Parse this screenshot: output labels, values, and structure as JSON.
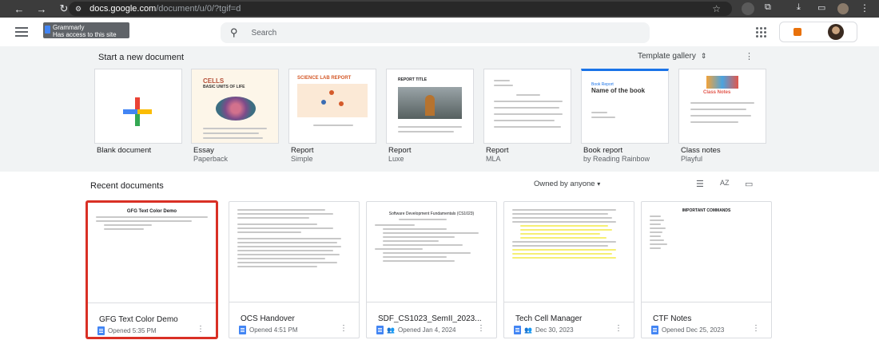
{
  "browser": {
    "url_host": "docs.google.com",
    "url_path": "/document/u/0/?tgif=d"
  },
  "grammarly": {
    "name": "Grammarly",
    "note": "Has access to this site"
  },
  "search": {
    "placeholder": "Search"
  },
  "templates": {
    "heading": "Start a new document",
    "gallery_label": "Template gallery",
    "items": [
      {
        "name": "Blank document",
        "sub": ""
      },
      {
        "name": "Essay",
        "sub": "Paperback"
      },
      {
        "name": "Report",
        "sub": "Simple"
      },
      {
        "name": "Report",
        "sub": "Luxe"
      },
      {
        "name": "Report",
        "sub": "MLA"
      },
      {
        "name": "Book report",
        "sub": "by Reading Rainbow"
      },
      {
        "name": "Class notes",
        "sub": "Playful"
      }
    ],
    "thumb_text": {
      "essay_title": "CELLS",
      "essay_sub": "BASIC UNITS OF LIFE",
      "science": "SCIENCE LAB REPORT",
      "luxe_title": "REPORT TITLE",
      "book_label": "Book Report",
      "book_title": "Name of the book",
      "class_title": "Class Notes"
    }
  },
  "recent": {
    "heading": "Recent documents",
    "owner_filter": "Owned by anyone",
    "docs": [
      {
        "name": "GFG Text Color Demo",
        "opened": "Opened 5:35 PM",
        "shared": false,
        "preview_title": "GFG Text Color Demo"
      },
      {
        "name": "OCS Handover",
        "opened": "Opened 4:51 PM",
        "shared": false,
        "preview_title": ""
      },
      {
        "name": "SDF_CS1023_SemII_2023...",
        "opened": "Opened Jan 4, 2024",
        "shared": true,
        "preview_title": "Software Development Fundamentals (CS1023)"
      },
      {
        "name": "Tech Cell Manager",
        "opened": "Dec 30, 2023",
        "shared": true,
        "preview_title": ""
      },
      {
        "name": "CTF Notes",
        "opened": "Opened Dec 25, 2023",
        "shared": false,
        "preview_title": "IMPORTANT COMMANDS"
      }
    ]
  },
  "colors": {
    "accent_blue": "#4285f4",
    "selection_red": "#d93025"
  }
}
